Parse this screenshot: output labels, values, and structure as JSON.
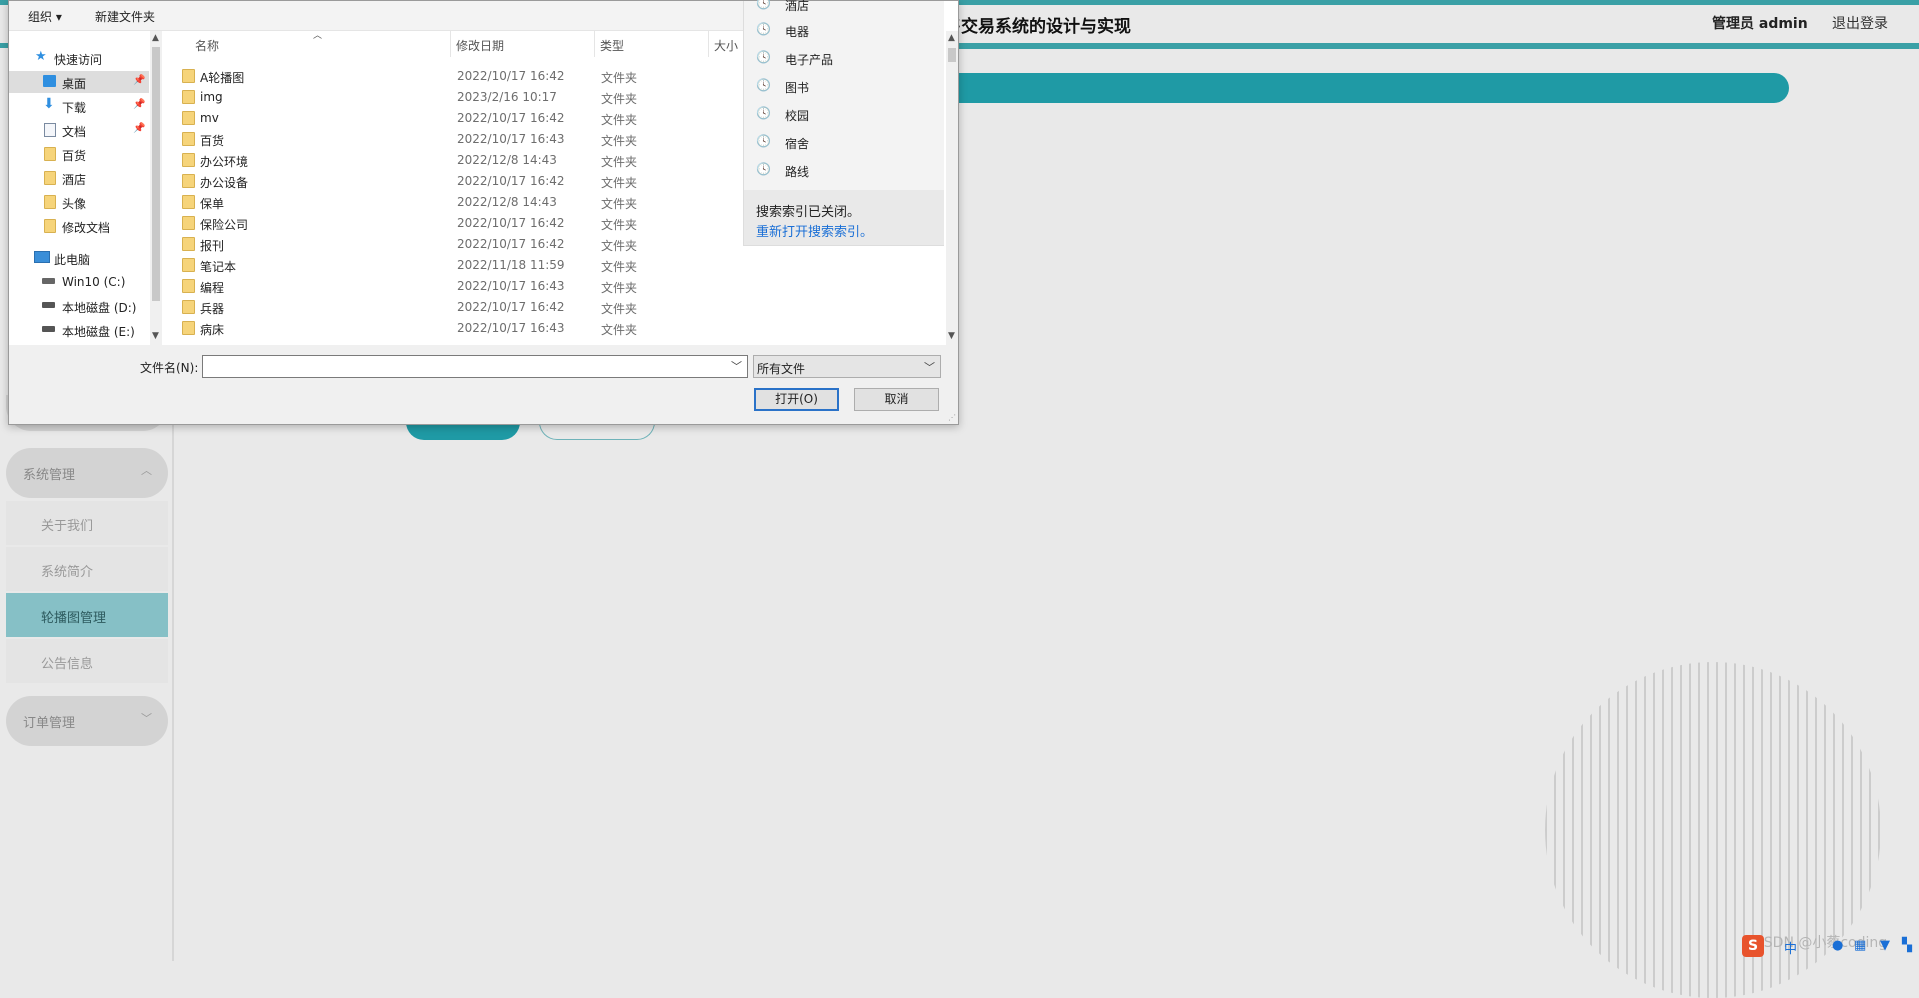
{
  "app": {
    "title": "售交易系统的设计与实现",
    "admin_label": "管理员 admin",
    "logout": "退出登录"
  },
  "sidebar": {
    "group_system": "系统管理",
    "sub_items": [
      "关于我们",
      "系统简介",
      "轮播图管理",
      "公告信息"
    ],
    "active_sub": "轮播图管理",
    "group_orders": "订单管理"
  },
  "dialog": {
    "toolbar": {
      "organize": "组织 ▾",
      "new_folder": "新建文件夹"
    },
    "nav": {
      "quick_access": "快速访问",
      "items": [
        "桌面",
        "下载",
        "文档",
        "百货",
        "酒店",
        "头像",
        "修改文档"
      ],
      "this_pc": "此电脑",
      "drives": [
        "Win10 (C:)",
        "本地磁盘 (D:)",
        "本地磁盘 (E:)"
      ]
    },
    "columns": {
      "name": "名称",
      "modified": "修改日期",
      "type": "类型",
      "size": "大小"
    },
    "rows": [
      {
        "name": "A轮播图",
        "modified": "2022/10/17 16:42",
        "type": "文件夹"
      },
      {
        "name": "img",
        "modified": "2023/2/16 10:17",
        "type": "文件夹"
      },
      {
        "name": "mv",
        "modified": "2022/10/17 16:42",
        "type": "文件夹"
      },
      {
        "name": "百货",
        "modified": "2022/10/17 16:43",
        "type": "文件夹"
      },
      {
        "name": "办公环境",
        "modified": "2022/12/8 14:43",
        "type": "文件夹"
      },
      {
        "name": "办公设备",
        "modified": "2022/10/17 16:42",
        "type": "文件夹"
      },
      {
        "name": "保单",
        "modified": "2022/12/8 14:43",
        "type": "文件夹"
      },
      {
        "name": "保险公司",
        "modified": "2022/10/17 16:42",
        "type": "文件夹"
      },
      {
        "name": "报刊",
        "modified": "2022/10/17 16:42",
        "type": "文件夹"
      },
      {
        "name": "笔记本",
        "modified": "2022/11/18 11:59",
        "type": "文件夹"
      },
      {
        "name": "编程",
        "modified": "2022/10/17 16:43",
        "type": "文件夹"
      },
      {
        "name": "兵器",
        "modified": "2022/10/17 16:42",
        "type": "文件夹"
      },
      {
        "name": "病床",
        "modified": "2022/10/17 16:43",
        "type": "文件夹"
      }
    ],
    "search_history": [
      "酒店",
      "电器",
      "电子产品",
      "图书",
      "校园",
      "宿舍",
      "路线"
    ],
    "search_notice": "搜索索引已关闭。",
    "search_link": "重新打开搜索索引。",
    "filename_label": "文件名(N):",
    "filename_value": "",
    "filter_value": "所有文件",
    "open_button": "打开(O)",
    "cancel_button": "取消"
  },
  "watermark": "CSDN @小蔡coding",
  "tray": {
    "logo": "S",
    "ime": "中"
  },
  "colors": {
    "accent": "#1f9aa5",
    "active_menu": "#86c0c6",
    "link": "#1a6fd6"
  }
}
